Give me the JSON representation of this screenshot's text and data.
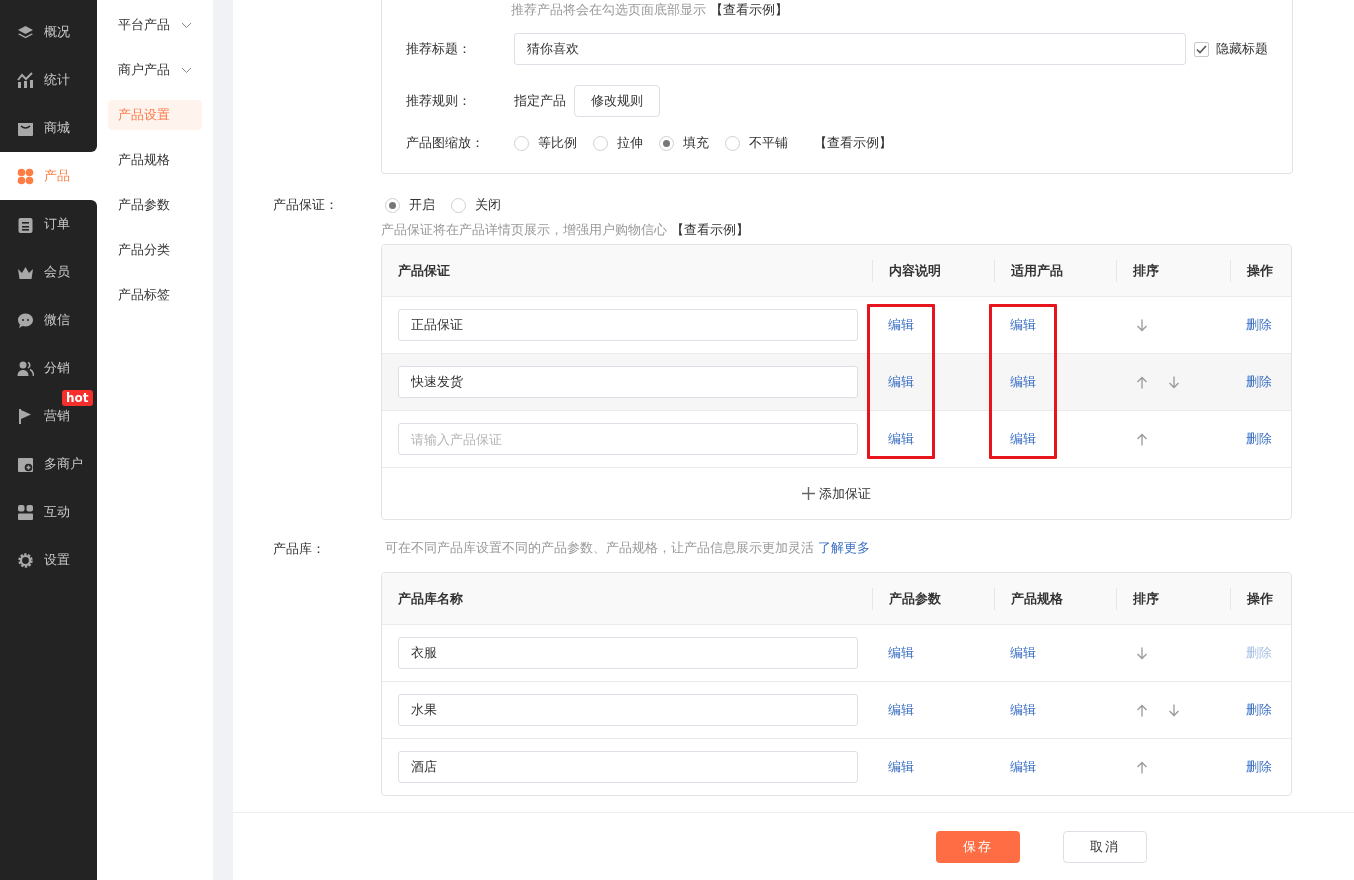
{
  "nav": [
    {
      "label": "概况",
      "selected": false
    },
    {
      "label": "统计",
      "selected": false
    },
    {
      "label": "商城",
      "selected": false
    },
    {
      "label": "产品",
      "selected": true
    },
    {
      "label": "订单",
      "selected": false
    },
    {
      "label": "会员",
      "selected": false
    },
    {
      "label": "微信",
      "selected": false
    },
    {
      "label": "分销",
      "selected": false
    },
    {
      "label": "营销",
      "selected": false,
      "badge": "hot"
    },
    {
      "label": "多商户",
      "selected": false
    },
    {
      "label": "互动",
      "selected": false
    },
    {
      "label": "设置",
      "selected": false
    }
  ],
  "sub_nav": [
    {
      "label": "平台产品",
      "kind": "group",
      "selected": false
    },
    {
      "label": "商户产品",
      "kind": "group",
      "selected": false
    },
    {
      "label": "产品设置",
      "kind": "link",
      "selected": true
    },
    {
      "label": "产品规格",
      "kind": "link",
      "selected": false
    },
    {
      "label": "产品参数",
      "kind": "link",
      "selected": false
    },
    {
      "label": "产品分类",
      "kind": "link",
      "selected": false
    },
    {
      "label": "产品标签",
      "kind": "link",
      "selected": false
    }
  ],
  "recommend": {
    "hint": "推荐产品将会在勾选页面底部显示",
    "hint_link": "【查看示例】",
    "title_label": "推荐标题：",
    "title_value": "猜你喜欢",
    "hide_title": {
      "label": "隐藏标题",
      "checked": true
    },
    "rule_label": "推荐规则：",
    "rule_value": "指定产品",
    "rule_button": "修改规则",
    "scale_label": "产品图缩放：",
    "scale_options": [
      {
        "label": "等比例",
        "selected": false
      },
      {
        "label": "拉伸",
        "selected": false
      },
      {
        "label": "填充",
        "selected": true
      },
      {
        "label": "不平铺",
        "selected": false
      }
    ],
    "scale_link": "【查看示例】"
  },
  "guarantee": {
    "label": "产品保证：",
    "options": [
      {
        "label": "开启",
        "selected": true
      },
      {
        "label": "关闭",
        "selected": false
      }
    ],
    "hint": "产品保证将在产品详情页展示，增强用户购物信心",
    "hint_link": "【查看示例】",
    "columns": [
      {
        "title": "产品保证",
        "highlighted": false
      },
      {
        "title": "内容说明",
        "highlighted": true
      },
      {
        "title": "适用产品",
        "highlighted": true
      },
      {
        "title": "排序",
        "highlighted": false
      },
      {
        "title": "操作",
        "highlighted": false
      }
    ],
    "rows": [
      {
        "value": "正品保证",
        "edit_1": "编辑",
        "edit_2": "编辑",
        "up": false,
        "down": true,
        "delete": "删除",
        "delete_disabled": false,
        "hovered": false
      },
      {
        "value": "快速发货",
        "edit_1": "编辑",
        "edit_2": "编辑",
        "up": true,
        "down": true,
        "delete": "删除",
        "delete_disabled": false,
        "hovered": true
      },
      {
        "placeholder": "请输入产品保证",
        "edit_1": "编辑",
        "edit_2": "编辑",
        "up": true,
        "down": false,
        "delete": "删除",
        "delete_disabled": false,
        "hovered": false
      }
    ],
    "add_button": "添加保证"
  },
  "library": {
    "label": "产品库：",
    "hint": "可在不同产品库设置不同的产品参数、产品规格，让产品信息展示更加灵活",
    "hint_link": "了解更多",
    "columns": [
      {
        "title": "产品库名称",
        "highlighted": false
      },
      {
        "title": "产品参数",
        "highlighted": false
      },
      {
        "title": "产品规格",
        "highlighted": false
      },
      {
        "title": "排序",
        "highlighted": false
      },
      {
        "title": "操作",
        "highlighted": false
      }
    ],
    "rows": [
      {
        "value": "衣服",
        "edit_1": "编辑",
        "edit_2": "编辑",
        "up": false,
        "down": true,
        "delete": "删除",
        "delete_disabled": true,
        "hovered": false
      },
      {
        "value": "水果",
        "edit_1": "编辑",
        "edit_2": "编辑",
        "up": true,
        "down": true,
        "delete": "删除",
        "delete_disabled": false,
        "hovered": false
      },
      {
        "value": "酒店",
        "edit_1": "编辑",
        "edit_2": "编辑",
        "up": true,
        "down": false,
        "delete": "删除",
        "delete_disabled": false,
        "hovered": false
      }
    ]
  },
  "footer": {
    "save": "保存",
    "cancel": "取消"
  }
}
